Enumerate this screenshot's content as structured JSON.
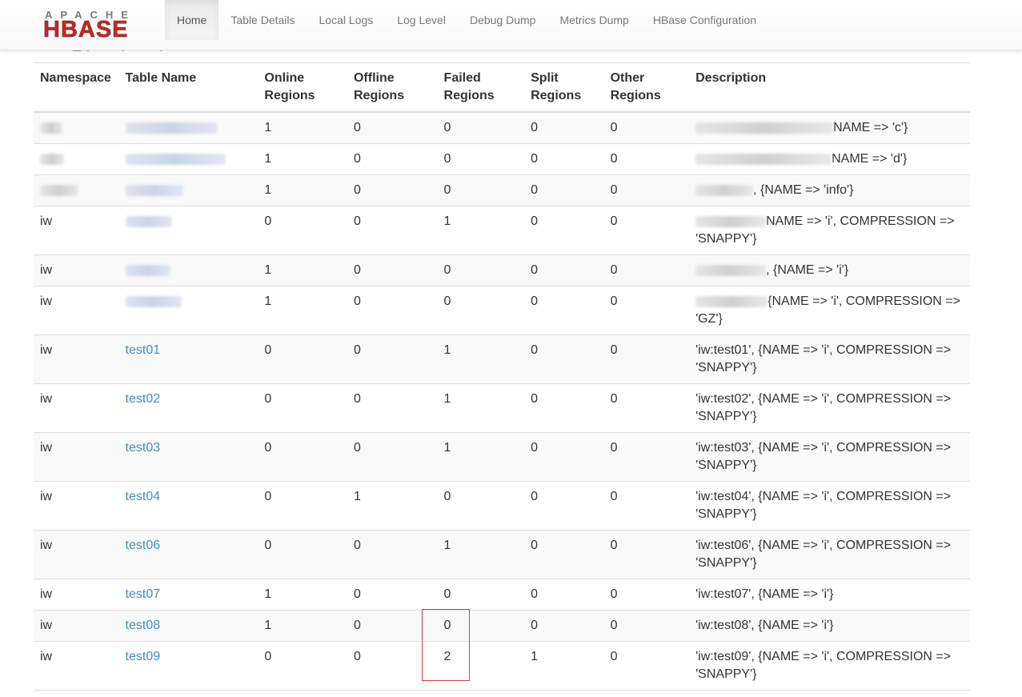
{
  "navbar": {
    "logo_top": "APACHE",
    "logo_main": "HBASE",
    "items": [
      {
        "label": "Home",
        "active": true
      },
      {
        "label": "Table Details",
        "active": false
      },
      {
        "label": "Local Logs",
        "active": false
      },
      {
        "label": "Log Level",
        "active": false
      },
      {
        "label": "Debug Dump",
        "active": false
      },
      {
        "label": "Metrics Dump",
        "active": false
      },
      {
        "label": "HBase Configuration",
        "active": false
      }
    ]
  },
  "table": {
    "headers": {
      "namespace": "Namespace",
      "table_name": "Table Name",
      "online": "Online Regions",
      "offline": "Offline Regions",
      "failed": "Failed Regions",
      "split": "Split Regions",
      "other": "Other Regions",
      "description": "Description"
    },
    "rows": [
      {
        "namespace": "",
        "table_name": "",
        "online": "1",
        "offline": "0",
        "failed": "0",
        "split": "0",
        "other": "0",
        "desc_prefix": "",
        "desc": "NAME => 'c'}"
      },
      {
        "namespace": "",
        "table_name": "",
        "online": "1",
        "offline": "0",
        "failed": "0",
        "split": "0",
        "other": "0",
        "desc_prefix": "",
        "desc": "NAME => 'd'}"
      },
      {
        "namespace": "",
        "table_name": "",
        "online": "1",
        "offline": "0",
        "failed": "0",
        "split": "0",
        "other": "0",
        "desc_prefix": "",
        "desc": ", {NAME => 'info'}"
      },
      {
        "namespace": "iw",
        "table_name": "",
        "online": "0",
        "offline": "0",
        "failed": "1",
        "split": "0",
        "other": "0",
        "desc_prefix": "",
        "desc": "NAME => 'i', COMPRESSION => 'SNAPPY'}"
      },
      {
        "namespace": "iw",
        "table_name": "",
        "online": "1",
        "offline": "0",
        "failed": "0",
        "split": "0",
        "other": "0",
        "desc_prefix": "",
        "desc": ", {NAME => 'i'}"
      },
      {
        "namespace": "iw",
        "table_name": "",
        "online": "1",
        "offline": "0",
        "failed": "0",
        "split": "0",
        "other": "0",
        "desc_prefix": "",
        "desc": "{NAME => 'i', COMPRESSION => 'GZ'}"
      },
      {
        "namespace": "iw",
        "table_name": "test01",
        "online": "0",
        "offline": "0",
        "failed": "1",
        "split": "0",
        "other": "0",
        "desc": "'iw:test01', {NAME => 'i', COMPRESSION => 'SNAPPY'}"
      },
      {
        "namespace": "iw",
        "table_name": "test02",
        "online": "0",
        "offline": "0",
        "failed": "1",
        "split": "0",
        "other": "0",
        "desc": "'iw:test02', {NAME => 'i', COMPRESSION => 'SNAPPY'}"
      },
      {
        "namespace": "iw",
        "table_name": "test03",
        "online": "0",
        "offline": "0",
        "failed": "1",
        "split": "0",
        "other": "0",
        "desc": "'iw:test03', {NAME => 'i', COMPRESSION => 'SNAPPY'}"
      },
      {
        "namespace": "iw",
        "table_name": "test04",
        "online": "0",
        "offline": "1",
        "failed": "0",
        "split": "0",
        "other": "0",
        "desc": "'iw:test04', {NAME => 'i', COMPRESSION => 'SNAPPY'}"
      },
      {
        "namespace": "iw",
        "table_name": "test06",
        "online": "0",
        "offline": "0",
        "failed": "1",
        "split": "0",
        "other": "0",
        "desc": "'iw:test06', {NAME => 'i', COMPRESSION => 'SNAPPY'}"
      },
      {
        "namespace": "iw",
        "table_name": "test07",
        "online": "1",
        "offline": "0",
        "failed": "0",
        "split": "0",
        "other": "0",
        "desc": "'iw:test07', {NAME => 'i'}"
      },
      {
        "namespace": "iw",
        "table_name": "test08",
        "online": "1",
        "offline": "0",
        "failed": "0",
        "split": "0",
        "other": "0",
        "desc": "'iw:test08', {NAME => 'i'}"
      },
      {
        "namespace": "iw",
        "table_name": "test09",
        "online": "0",
        "offline": "0",
        "failed": "2",
        "split": "1",
        "other": "0",
        "desc": "'iw:test09', {NAME => 'i', COMPRESSION => 'SNAPPY'}"
      }
    ]
  },
  "colors": {
    "link": "#428bca",
    "logo_red": "#c22a24",
    "highlight": "#e03a3a"
  }
}
